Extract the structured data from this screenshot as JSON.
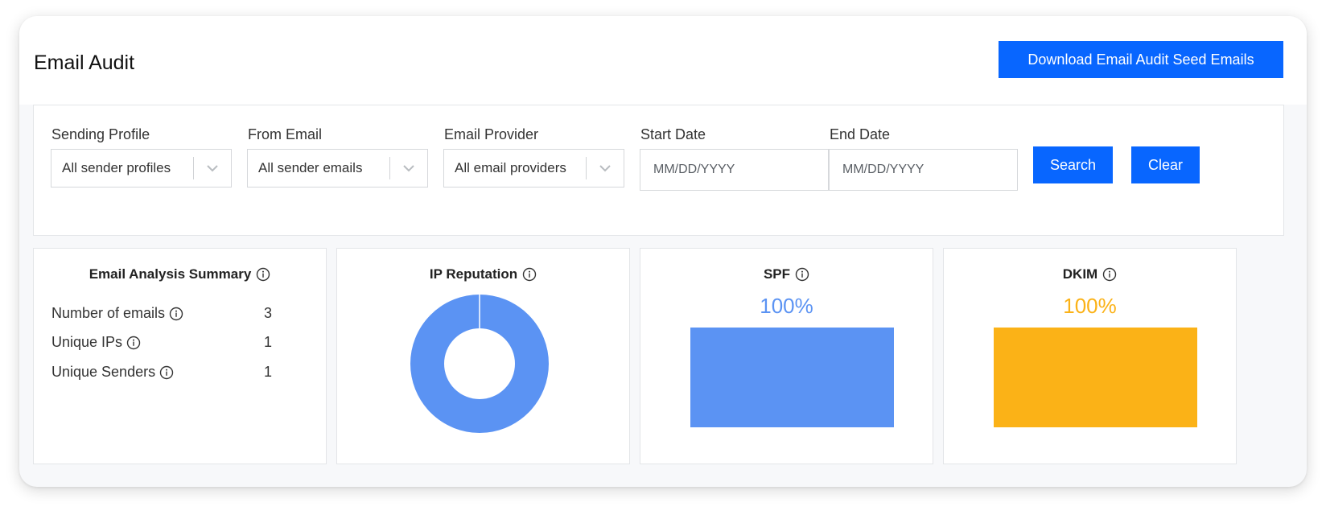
{
  "page": {
    "title": "Email Audit",
    "download_label": "Download Email Audit Seed Emails"
  },
  "filters": {
    "sending_profile": {
      "label": "Sending Profile",
      "value": "All sender profiles"
    },
    "from_email": {
      "label": "From Email",
      "value": "All sender emails"
    },
    "email_provider": {
      "label": "Email Provider",
      "value": "All email providers"
    },
    "start_date": {
      "label": "Start Date",
      "placeholder": "MM/DD/YYYY"
    },
    "end_date": {
      "label": "End Date",
      "placeholder": "MM/DD/YYYY"
    },
    "search_label": "Search",
    "clear_label": "Clear"
  },
  "summary": {
    "title": "Email Analysis Summary",
    "rows": [
      {
        "label": "Number of emails",
        "value": "3"
      },
      {
        "label": "Unique IPs",
        "value": "1"
      },
      {
        "label": "Unique Senders",
        "value": "1"
      }
    ]
  },
  "ip_reputation": {
    "title": "IP Reputation",
    "donut_color": "#5b93f3",
    "chart_data": {
      "type": "pie",
      "values": [
        100
      ]
    }
  },
  "spf": {
    "title": "SPF",
    "percent_label": "100%",
    "percent": 100,
    "color": "#5b93f3"
  },
  "dkim": {
    "title": "DKIM",
    "percent_label": "100%",
    "percent": 100,
    "color": "#fbb217"
  },
  "icons": [
    "info-icon",
    "chevron-down-icon"
  ],
  "colors": {
    "accent": "#0866ff"
  }
}
